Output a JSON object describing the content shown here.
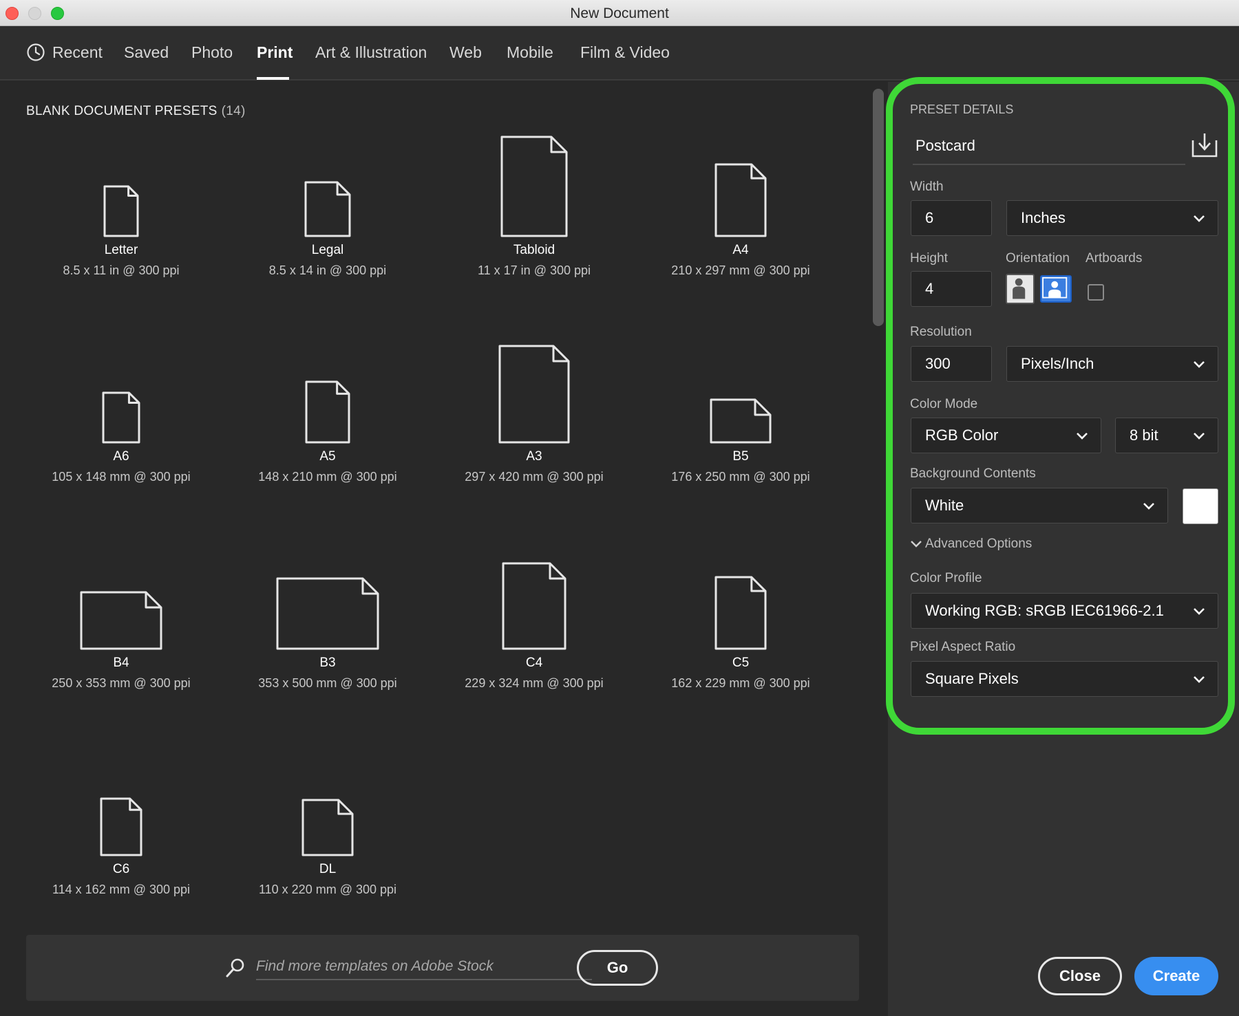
{
  "window": {
    "title": "New Document"
  },
  "tabs": [
    {
      "label": "Recent",
      "icon": "clock-icon"
    },
    {
      "label": "Saved"
    },
    {
      "label": "Photo"
    },
    {
      "label": "Print",
      "active": true
    },
    {
      "label": "Art & Illustration"
    },
    {
      "label": "Web"
    },
    {
      "label": "Mobile"
    },
    {
      "label": "Film & Video"
    }
  ],
  "presets_section": {
    "title": "BLANK DOCUMENT PRESETS",
    "count": "(14)"
  },
  "presets": [
    {
      "name": "Letter",
      "dims": "8.5 x 11 in @ 300 ppi"
    },
    {
      "name": "Legal",
      "dims": "8.5 x 14 in @ 300 ppi"
    },
    {
      "name": "Tabloid",
      "dims": "11 x 17 in @ 300 ppi"
    },
    {
      "name": "A4",
      "dims": "210 x 297 mm @ 300 ppi"
    },
    {
      "name": "A6",
      "dims": "105 x 148 mm @ 300 ppi"
    },
    {
      "name": "A5",
      "dims": "148 x 210 mm @ 300 ppi"
    },
    {
      "name": "A3",
      "dims": "297 x 420 mm @ 300 ppi"
    },
    {
      "name": "B5",
      "dims": "176 x 250 mm @ 300 ppi"
    },
    {
      "name": "B4",
      "dims": "250 x 353 mm @ 300 ppi"
    },
    {
      "name": "B3",
      "dims": "353 x 500 mm @ 300 ppi"
    },
    {
      "name": "C4",
      "dims": "229 x 324 mm @ 300 ppi"
    },
    {
      "name": "C5",
      "dims": "162 x 229 mm @ 300 ppi"
    },
    {
      "name": "C6",
      "dims": "114 x 162 mm @ 300 ppi"
    },
    {
      "name": "DL",
      "dims": "110 x 220 mm @ 300 ppi"
    }
  ],
  "search": {
    "placeholder": "Find more templates on Adobe Stock",
    "go_label": "Go"
  },
  "details": {
    "section_title": "PRESET DETAILS",
    "preset_name": "Postcard",
    "width_label": "Width",
    "width_value": "6",
    "width_unit": "Inches",
    "height_label": "Height",
    "height_value": "4",
    "orientation_label": "Orientation",
    "orientation_selected": "landscape",
    "artboards_label": "Artboards",
    "artboards_checked": false,
    "resolution_label": "Resolution",
    "resolution_value": "300",
    "resolution_unit": "Pixels/Inch",
    "color_mode_label": "Color Mode",
    "color_mode": "RGB Color",
    "bit_depth": "8 bit",
    "background_label": "Background Contents",
    "background": "White",
    "background_swatch": "#ffffff",
    "advanced_label": "Advanced Options",
    "color_profile_label": "Color Profile",
    "color_profile": "Working RGB: sRGB IEC61966-2.1",
    "pixel_aspect_label": "Pixel Aspect Ratio",
    "pixel_aspect": "Square Pixels"
  },
  "actions": {
    "close_label": "Close",
    "create_label": "Create"
  },
  "colors": {
    "accent": "#378ef0",
    "highlight": "#3fd837"
  }
}
